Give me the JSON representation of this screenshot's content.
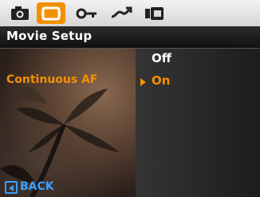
{
  "tabs": [
    {
      "id": "camera",
      "icon": "camera-icon",
      "active": false
    },
    {
      "id": "movie",
      "icon": "movie-icon",
      "active": true
    },
    {
      "id": "playback",
      "icon": "key-icon",
      "active": false
    },
    {
      "id": "effect",
      "icon": "wave-icon",
      "active": false
    },
    {
      "id": "settings",
      "icon": "setup-icon",
      "active": false
    }
  ],
  "header": {
    "title": "Movie Setup"
  },
  "setting": {
    "label": "Continuous AF"
  },
  "options": [
    {
      "label": "Off",
      "selected": false
    },
    {
      "label": "On",
      "selected": true
    }
  ],
  "footer": {
    "back_label": "BACK"
  },
  "colors": {
    "accent": "#f39000",
    "back": "#3aa0ff",
    "title_text": "#ffffff"
  }
}
